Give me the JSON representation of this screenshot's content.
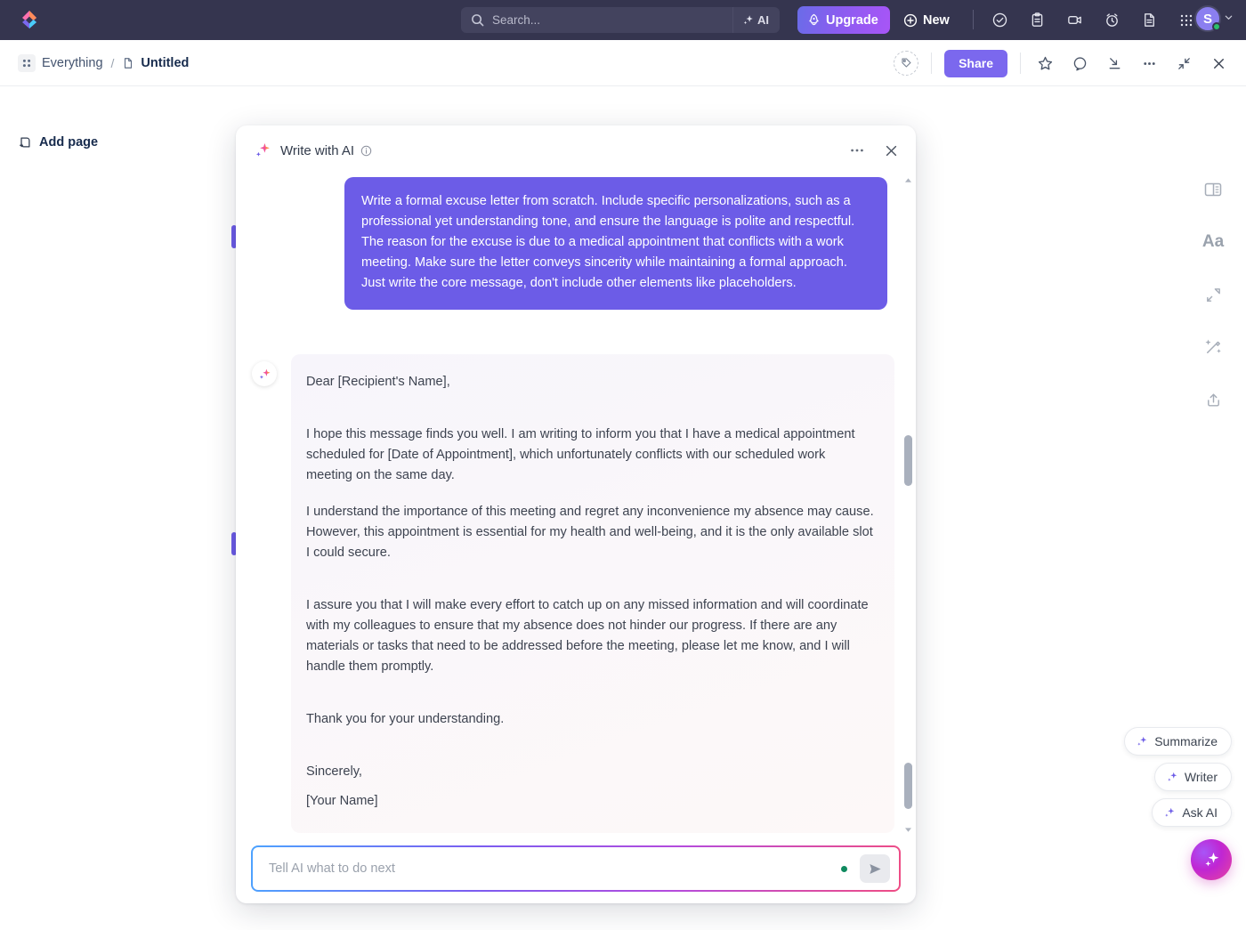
{
  "topbar": {
    "logo_icon": "clickup-logo-icon",
    "search": {
      "placeholder": "Search...",
      "icon": "search-icon",
      "ai_label": "AI",
      "ai_icon": "sparkle-icon"
    },
    "upgrade_label": "Upgrade",
    "upgrade_icon": "rocket-icon",
    "new_label": "New",
    "new_icon": "plus-circle-icon",
    "icons": [
      "check-circle-icon",
      "clipboard-icon",
      "video-camera-icon",
      "alarm-clock-icon",
      "document-icon",
      "apps-grid-icon"
    ],
    "avatar_initial": "S",
    "avatar_chevron_icon": "chevron-down-icon",
    "accent": "#7b68ee"
  },
  "breadcrumb": {
    "space_icon": "grid-dots-icon",
    "space_label": "Everything",
    "separator": "/",
    "doc_icon": "document-icon",
    "current_label": "Untitled"
  },
  "doc_actions": {
    "tag_icon": "tag-icon",
    "share_label": "Share",
    "icons": [
      "star-icon",
      "search-circle-icon",
      "collapse-down-icon",
      "more-horizontal-icon",
      "minimize-icon",
      "close-icon"
    ]
  },
  "left_panel": {
    "add_page_label": "Add page",
    "add_page_icon": "add-page-icon"
  },
  "right_rail": {
    "icons": [
      "panel-layout-icon",
      "font-size-icon",
      "resize-arrows-icon",
      "magic-wand-icon",
      "share-upload-icon"
    ],
    "font_label": "Aa"
  },
  "ai_chips": [
    {
      "label": "Summarize",
      "icon": "sparkle-icon"
    },
    {
      "label": "Writer",
      "icon": "sparkle-icon"
    },
    {
      "label": "Ask AI",
      "icon": "sparkle-icon"
    }
  ],
  "fab": {
    "icon": "sparkle-icon"
  },
  "modal": {
    "title": "Write with AI",
    "title_icon": "sparkle-icon",
    "info_icon": "info-circle-icon",
    "more_icon": "more-horizontal-icon",
    "close_icon": "close-icon",
    "user_message": "Write a formal excuse letter from scratch. Include specific personalizations, such as a professional yet understanding tone, and ensure the language is polite and respectful. The reason for the excuse is due to a medical appointment that conflicts with a work meeting. Make sure the letter conveys sincerity while maintaining a formal approach. Just write the core message, don't include other elements like placeholders.",
    "ai_avatar_icon": "sparkle-icon",
    "ai_response": {
      "salutation": "Dear [Recipient's Name],",
      "para1": "I hope this message finds you well. I am writing to inform you that I have a medical appointment scheduled for [Date of Appointment], which unfortunately conflicts with our scheduled work meeting on the same day.",
      "para2": "I understand the importance of this meeting and regret any inconvenience my absence may cause. However, this appointment is essential for my health and well-being, and it is the only available slot I could secure.",
      "para3": "I assure you that I will make every effort to catch up on any missed information and will coordinate with my colleagues to ensure that my absence does not hinder our progress. If there are any materials or tasks that need to be addressed before the meeting, please let me know, and I will handle them promptly.",
      "closing_thanks": "Thank you for your understanding.",
      "sign_off": "Sincerely,",
      "signature": "[Your Name]"
    },
    "input": {
      "placeholder": "Tell AI what to do next",
      "value": "",
      "send_icon": "send-icon",
      "status_dot": "online-dot"
    }
  }
}
